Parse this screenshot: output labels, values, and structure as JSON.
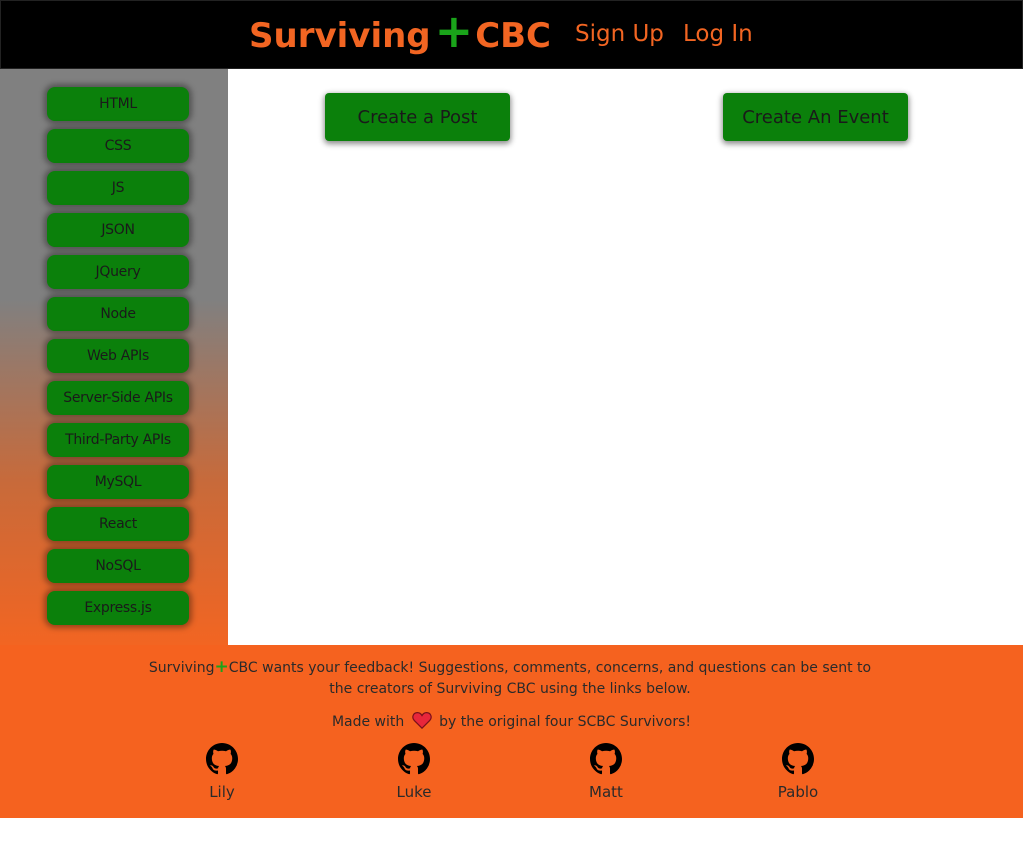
{
  "header": {
    "brand_left": "Surviving",
    "brand_plus": "+",
    "brand_right": "CBC",
    "signup": "Sign Up",
    "login": "Log In"
  },
  "sidebar": {
    "items": [
      {
        "label": "HTML"
      },
      {
        "label": "CSS"
      },
      {
        "label": "JS"
      },
      {
        "label": "JSON"
      },
      {
        "label": "JQuery"
      },
      {
        "label": "Node"
      },
      {
        "label": "Web APIs"
      },
      {
        "label": "Server-Side APIs"
      },
      {
        "label": "Third-Party APIs"
      },
      {
        "label": "MySQL"
      },
      {
        "label": "React"
      },
      {
        "label": "NoSQL"
      },
      {
        "label": "Express.js"
      }
    ]
  },
  "main": {
    "create_post": "Create a Post",
    "create_event": "Create An Event"
  },
  "footer": {
    "feedback_brand_left": "Surviving",
    "feedback_plus": "+",
    "feedback_text": "CBC wants your feedback! Suggestions, comments, concerns, and questions can be sent to the creators of Surviving CBC using the links below.",
    "made_with_prefix": "Made with",
    "made_with_suffix": "by the original four SCBC Survivors!",
    "contributors": [
      {
        "name": "Lily",
        "icon": "github-icon"
      },
      {
        "name": "Luke",
        "icon": "github-icon"
      },
      {
        "name": "Matt",
        "icon": "github-icon"
      },
      {
        "name": "Pablo",
        "icon": "github-icon"
      }
    ]
  },
  "colors": {
    "accent_orange": "#f26522",
    "button_green": "#0b800b",
    "plus_green": "#1aa41a",
    "header_bg": "#000000"
  }
}
